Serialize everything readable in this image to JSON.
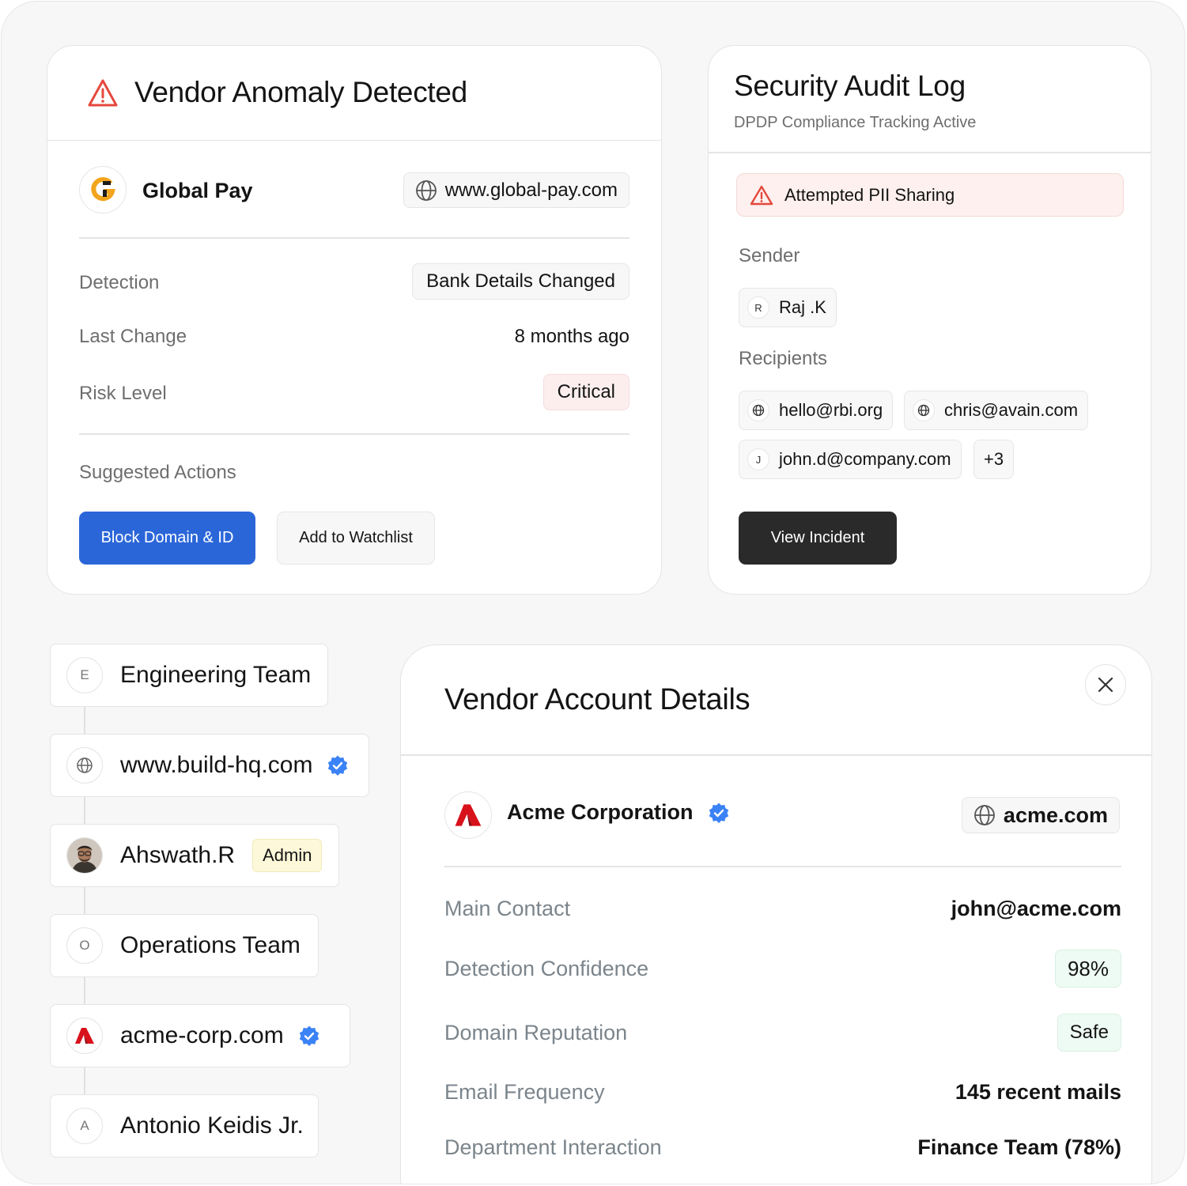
{
  "anomaly_card": {
    "title": "Vendor Anomaly Detected",
    "vendor_name": "Global Pay",
    "vendor_url": "www.global-pay.com",
    "rows": [
      {
        "label": "Detection",
        "value": "Bank Details Changed"
      },
      {
        "label": "Last Change",
        "value": "8 months ago"
      },
      {
        "label": "Risk Level",
        "value": "Critical"
      }
    ],
    "suggested_actions_label": "Suggested Actions",
    "primary_action": "Block Domain & ID",
    "secondary_action": "Add to Watchlist"
  },
  "audit_card": {
    "title": "Security Audit Log",
    "subtitle": "DPDP Compliance Tracking Active",
    "alert_text": "Attempted PII Sharing",
    "sender_label": "Sender",
    "sender": {
      "initial": "R",
      "name": "Raj .K"
    },
    "recipients_label": "Recipients",
    "recipients": [
      {
        "icon": "globe-icon",
        "email": "hello@rbi.org"
      },
      {
        "icon": "globe-icon",
        "email": "chris@avain.com"
      },
      {
        "initial": "J",
        "email": "john.d@company.com"
      }
    ],
    "more_count": "+3",
    "action": "View Incident"
  },
  "tree": {
    "items": [
      {
        "initial": "E",
        "label": "Engineering Team"
      },
      {
        "icon": "globe-icon",
        "label": "www.build-hq.com",
        "verified": true
      },
      {
        "icon": "avatar",
        "label": "Ahswath.R",
        "badge": "Admin"
      },
      {
        "initial": "O",
        "label": "Operations Team"
      },
      {
        "icon": "acme-logo",
        "label": "acme-corp.com",
        "verified": true
      },
      {
        "initial": "A",
        "label": "Antonio Keidis Jr."
      }
    ]
  },
  "details_card": {
    "title": "Vendor Account Details",
    "vendor_name": "Acme Corporation",
    "vendor_url": "acme.com",
    "rows": [
      {
        "label": "Main Contact",
        "value": "john@acme.com"
      },
      {
        "label": "Detection Confidence",
        "value": "98%"
      },
      {
        "label": "Domain Reputation",
        "value": "Safe"
      },
      {
        "label": "Email Frequency",
        "value": "145 recent mails"
      },
      {
        "label": "Department Interaction",
        "value": "Finance Team (78%)"
      }
    ]
  },
  "colors": {
    "primary_blue": "#2b66d9",
    "danger_red": "#e5483d",
    "verified_blue": "#3b82f6",
    "acme_red": "#d8121b",
    "dark_button": "#2a2a2a"
  }
}
